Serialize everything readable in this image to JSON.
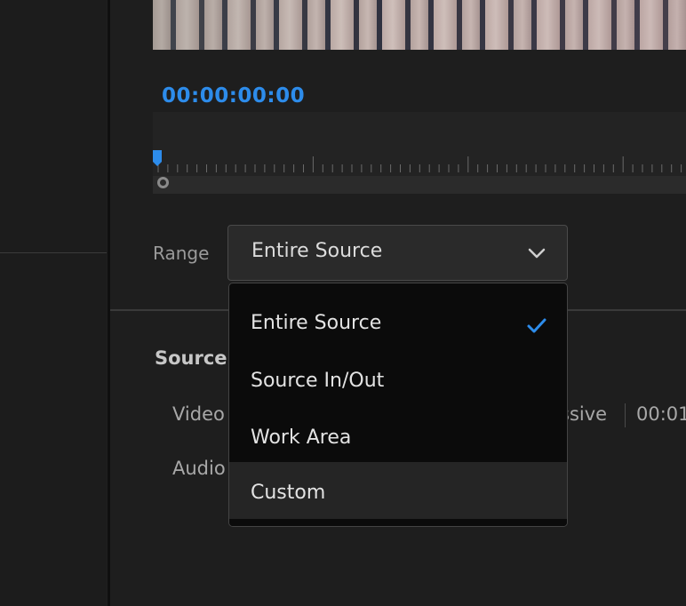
{
  "player": {
    "timecode": "00:00:00:00"
  },
  "range": {
    "label": "Range",
    "selected": "Entire Source",
    "options": [
      {
        "label": "Entire Source",
        "checked": true
      },
      {
        "label": "Source In/Out",
        "checked": false
      },
      {
        "label": "Work Area",
        "checked": false
      },
      {
        "label": "Custom",
        "checked": false,
        "hovered": true
      }
    ]
  },
  "source": {
    "heading": "Source",
    "video_label": "Video",
    "audio_label": "Audio",
    "video_info_tail": "ssive",
    "video_info_time": "00:01"
  },
  "colors": {
    "accent": "#2d8ceb",
    "background": "#1e1e1e",
    "menu_background": "#0b0b0b"
  },
  "icons": {
    "dropdown": "chevron-down-icon",
    "selected": "checkmark-icon",
    "playhead": "playhead-icon"
  }
}
